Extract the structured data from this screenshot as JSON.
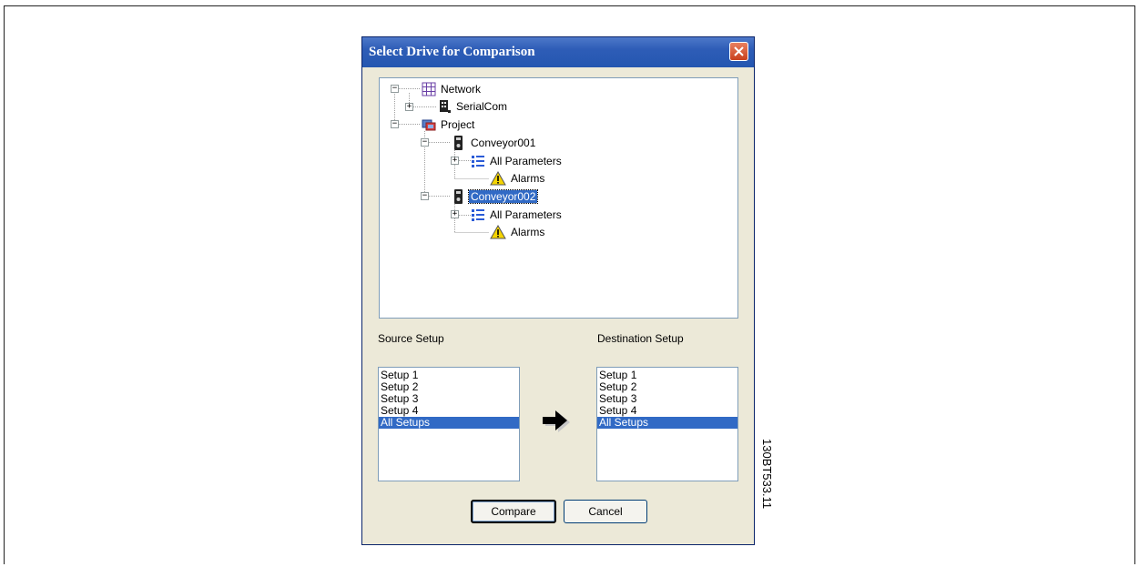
{
  "dialog": {
    "title": "Select Drive for Comparison",
    "close_label": "×"
  },
  "tree": {
    "network": "Network",
    "serialcom": "SerialCom",
    "project": "Project",
    "conveyor001": "Conveyor001",
    "c1_params": "All Parameters",
    "c1_alarms": "Alarms",
    "conveyor002": "Conveyor002",
    "c2_params": "All Parameters",
    "c2_alarms": "Alarms"
  },
  "source": {
    "label": "Source Setup",
    "items": [
      "Setup 1",
      "Setup 2",
      "Setup 3",
      "Setup 4",
      "All Setups"
    ],
    "selected": "All Setups"
  },
  "destination": {
    "label": "Destination Setup",
    "items": [
      "Setup 1",
      "Setup 2",
      "Setup 3",
      "Setup 4",
      "All Setups"
    ],
    "selected": "All Setups"
  },
  "buttons": {
    "compare": "Compare",
    "cancel": "Cancel"
  },
  "figure_code": "130BT533.11",
  "colors": {
    "title_bar": "#2456b0",
    "selection": "#316ac5",
    "dialog_bg": "#ece9d8",
    "close_button": "#c9401c"
  }
}
